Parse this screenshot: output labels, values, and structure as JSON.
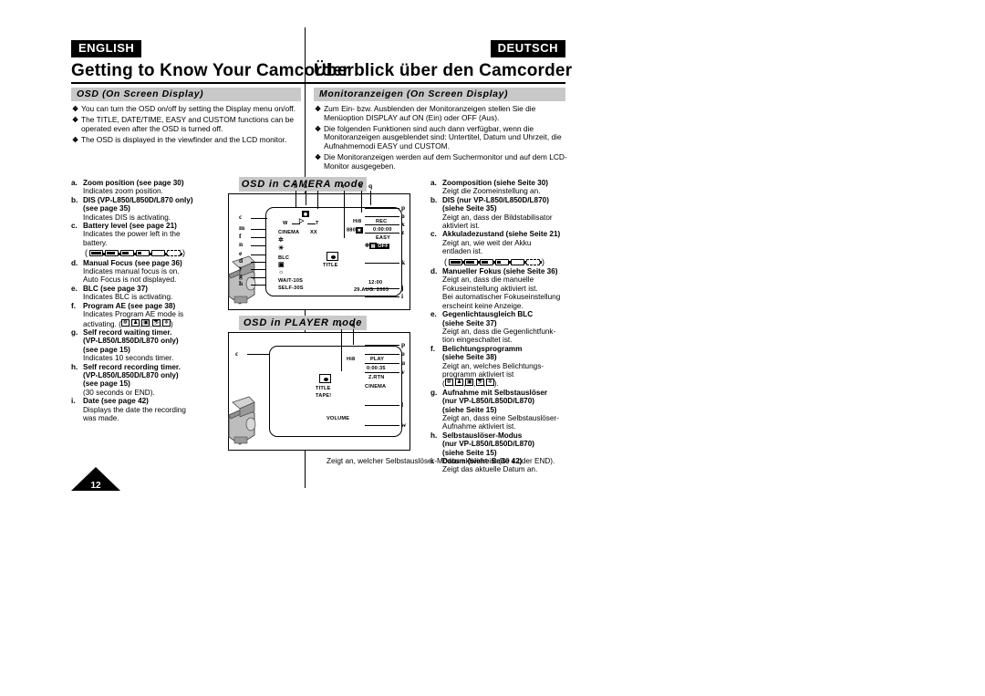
{
  "header": {
    "left_lang": "ENGLISH",
    "right_lang": "DEUTSCH",
    "left_title": "Getting to Know Your Camcorder",
    "right_title": "Überblick über den Camcorder"
  },
  "sections": {
    "left_bar": "OSD (On Screen Display)",
    "right_bar": "Monitoranzeigen (On Screen Display)"
  },
  "bullets_left": [
    "You can turn the OSD on/off by setting the Display menu on/off.",
    "The TITLE, DATE/TIME, EASY and CUSTOM functions can be operated even after the OSD is turned off.",
    "The OSD is displayed in the viewfinder and the LCD monitor."
  ],
  "bullets_right": [
    "Zum Ein- bzw. Ausblenden der Monitoranzeigen stellen Sie die Menüoption DISPLAY auf ON (Ein) oder OFF (Aus).",
    "Die folgenden Funktionen sind auch dann verfügbar, wenn die Monitoranzeigen ausgeblendet sind: Untertitel, Datum und Uhrzeit, die Aufnahmemodi EASY und CUSTOM.",
    "Die Monitoranzeigen werden auf dem Suchermonitor und auf dem LCD-Monitor ausgegeben."
  ],
  "list_left": [
    {
      "key": "a.",
      "head": "Zoom position (see page 30)",
      "subs": [
        "Indicates zoom position."
      ]
    },
    {
      "key": "b.",
      "head": "DIS (VP-L850/L850D/L870 only)",
      "head2": "(see page 35)",
      "subs": [
        "Indicates DIS is activating."
      ]
    },
    {
      "key": "c.",
      "head": "Battery level (see page 21)",
      "subs": [
        "Indicates the power left in the",
        "battery."
      ],
      "battery": true
    },
    {
      "key": "d.",
      "head": "Manual Focus (see page 36)",
      "subs": [
        "Indicates manual focus is on.",
        "Auto Focus is not displayed."
      ]
    },
    {
      "key": "e.",
      "head": "BLC (see page 37)",
      "subs": [
        "Indicates BLC is activating."
      ]
    },
    {
      "key": "f.",
      "head": "Program AE (see page 38)",
      "subs": [
        "Indicates Program AE mode is"
      ],
      "ae_prefix": "activating. (",
      "ae_suffix": ")"
    },
    {
      "key": "g.",
      "head": "Self record waiting timer.",
      "head2": "(VP-L850/L850D/L870 only)",
      "head3": "(see page 15)",
      "subs": [
        "Indicates 10 seconds timer."
      ]
    },
    {
      "key": "h.",
      "head": "Self record recording timer.",
      "head2": "(VP-L850/L850D/L870 only)",
      "head3": "(see page 15)",
      "subs": [
        "(30 seconds or END)."
      ]
    },
    {
      "key": "i.",
      "head": "Date (see page 42)",
      "subs": [
        "Displays the date the recording",
        "was made."
      ]
    }
  ],
  "list_right": [
    {
      "key": "a.",
      "head": "Zoomposition (siehe Seite 30)",
      "subs": [
        "Zeigt die Zoomeinstellung an."
      ]
    },
    {
      "key": "b.",
      "head": "DIS (nur VP-L850/L850D/L870)",
      "head2": "(siehe Seite 35)",
      "subs": [
        "Zeigt an, dass der Bildstabilisator",
        "aktiviert ist."
      ]
    },
    {
      "key": "c.",
      "head": "Akkuladezustand (siehe Seite 21)",
      "subs": [
        "Zeigt an, wie weit der Akku",
        "entladen ist."
      ],
      "battery": true
    },
    {
      "key": "d.",
      "head": "Manueller Fokus (siehe Seite 36)",
      "subs": [
        "Zeigt an, dass die manuelle",
        "Fokuseinstellung aktiviert ist.",
        "Bei automatischer Fokuseinstellung",
        "erscheint keine Anzeige."
      ]
    },
    {
      "key": "e.",
      "head": "Gegenlichtausgleich BLC",
      "head2": "(siehe Seite 37)",
      "subs": [
        "Zeigt an, dass die Gegenlichtfunk-",
        "tion eingeschaltet ist."
      ]
    },
    {
      "key": "f.",
      "head": "Belichtungsprogramm",
      "head2": "(siehe Seite 38)",
      "subs": [
        "Zeigt an, welches Belichtungs-",
        "programm aktiviert ist"
      ],
      "ae_prefix": "(",
      "ae_suffix": ")."
    },
    {
      "key": "g.",
      "head": "Aufnahme mit Selbstauslöser",
      "head2": "(nur VP-L850/L850D/L870)",
      "head3": "(siehe Seite 15)",
      "subs": [
        "Zeigt an, dass eine Selbstauslöser-",
        "Aufnahme aktiviert ist."
      ]
    },
    {
      "key": "h.",
      "head": "Selbstauslöser-Modus",
      "head2": "(nur VP-L850/L850D/L870)",
      "head3": "(siehe Seite 15)",
      "subs": []
    },
    {
      "key": "i.",
      "head": "Datum (siehe Seite 42)",
      "subs": [
        "Zeigt das aktuelle Datum an."
      ]
    }
  ],
  "right_note": "Zeigt an, welcher Selbstauslöser-Modus aktiviert ist (30 s oder END).",
  "diagrams": {
    "camera_bar": "OSD in CAMERA mode",
    "player_bar": "OSD in PLAYER mode",
    "camera_markers_top": [
      "b",
      "a",
      "t",
      "r",
      "s",
      "q"
    ],
    "camera_markers_left": [
      "c",
      "m",
      "f",
      "n",
      "e",
      "d",
      "y",
      "g",
      "h"
    ],
    "camera_markers_right": [
      "p",
      "o",
      "x",
      "z",
      "k",
      "j",
      "i"
    ],
    "camera_osd": {
      "zoom_w": "W",
      "zoom_t": "T",
      "cinema": "CINEMA",
      "xx": "XX",
      "hi8": "Hi8",
      "rec": "REC",
      "dis": "880",
      "counter": "0:00:00",
      "easy": "EASY",
      "off": "OFF",
      "blc": "BLC",
      "wait": "WAIT-10S",
      "self": "SELF-30S",
      "title": "TITLE",
      "time": "12:00",
      "date": "29.AUG. 2003"
    },
    "player_markers_top": [
      "r",
      "q"
    ],
    "player_markers_left": [
      "c"
    ],
    "player_markers_right": [
      "p",
      "o",
      "u",
      "v",
      "l",
      "w"
    ],
    "player_osd": {
      "hi8": "Hi8",
      "play": "PLAY",
      "counter": "0:00:35",
      "zrtn": "Z.RTN",
      "cinema": "CINEMA",
      "title": "TITLE",
      "tape": "TAPE!",
      "volume": "VOLUME"
    }
  },
  "page_number": "12",
  "colors": {
    "bar_gray": "#c8c8c8",
    "ink": "#000000",
    "paper": "#ffffff"
  }
}
